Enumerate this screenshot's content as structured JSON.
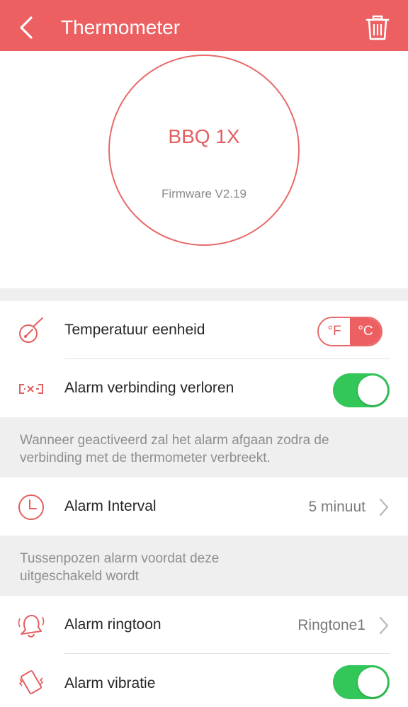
{
  "header": {
    "title": "Thermometer",
    "back_icon": "chevron-left-icon",
    "delete_icon": "trash-icon",
    "color": "#ec6062"
  },
  "device": {
    "name": "BBQ 1X",
    "firmware": "Firmware V2.19",
    "accent_color": "#e35f60"
  },
  "settings": {
    "temp_unit": {
      "icon": "thermometer-gauge-icon",
      "label": "Temperatuur eenheid",
      "options": [
        "°F",
        "°C"
      ],
      "selected": "°C"
    },
    "connection_alarm": {
      "icon": "disconnected-link-icon",
      "label": "Alarm verbinding verloren",
      "enabled": true,
      "note": "Wanneer geactiveerd zal het alarm afgaan zodra de verbinding met de thermometer verbreekt."
    },
    "alarm_interval": {
      "icon": "clock-icon",
      "label": "Alarm Interval",
      "value": "5 minuut",
      "note": "Tussenpozen alarm voordat deze uitgeschakeld wordt"
    },
    "alarm_ringtone": {
      "icon": "bell-icon",
      "label": "Alarm ringtoon",
      "value": "Ringtone1"
    },
    "alarm_vibration": {
      "icon": "vibrating-phone-icon",
      "label": "Alarm vibratie",
      "enabled": true
    }
  },
  "colors": {
    "toggle_on": "#33c659",
    "section_bg": "#efefef"
  }
}
